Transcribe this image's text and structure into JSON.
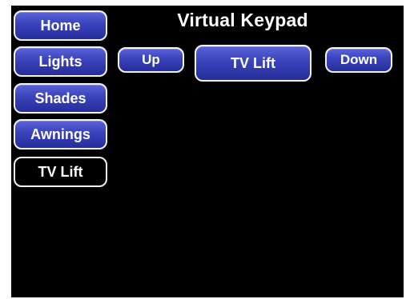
{
  "header": {
    "title": "Virtual Keypad"
  },
  "sidebar": {
    "items": [
      {
        "label": "Home"
      },
      {
        "label": "Lights"
      },
      {
        "label": "Shades"
      },
      {
        "label": "Awnings"
      },
      {
        "label": "TV Lift",
        "active": true
      }
    ]
  },
  "controls": {
    "up_label": "Up",
    "main_label": "TV Lift",
    "down_label": "Down"
  },
  "colors": {
    "background": "#000000",
    "button_blue": "#3a42bc",
    "border": "#f4f4f4",
    "text": "#ffffff"
  }
}
